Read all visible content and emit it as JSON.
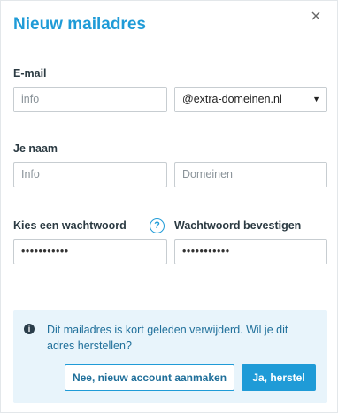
{
  "dialog": {
    "title": "Nieuw mailadres",
    "close_icon": "close-icon"
  },
  "email": {
    "label": "E-mail",
    "placeholder": "info",
    "domain_selected": "@extra-domeinen.nl"
  },
  "name": {
    "label": "Je naam",
    "first_placeholder": "Info",
    "last_placeholder": "Domeinen"
  },
  "password": {
    "label": "Kies een wachtwoord",
    "help_icon": "question-icon",
    "value": "•••••••••••",
    "confirm_label": "Wachtwoord bevestigen",
    "confirm_value": "•••••••••••"
  },
  "notice": {
    "icon": "info-icon",
    "message": "Dit mailadres is kort geleden verwijderd. Wil je dit adres herstellen?",
    "secondary_button": "Nee, nieuw account aanmaken",
    "primary_button": "Ja, herstel"
  },
  "colors": {
    "accent": "#1f9bd7",
    "notice_bg": "#e8f4fb",
    "text": "#2b3a42"
  }
}
